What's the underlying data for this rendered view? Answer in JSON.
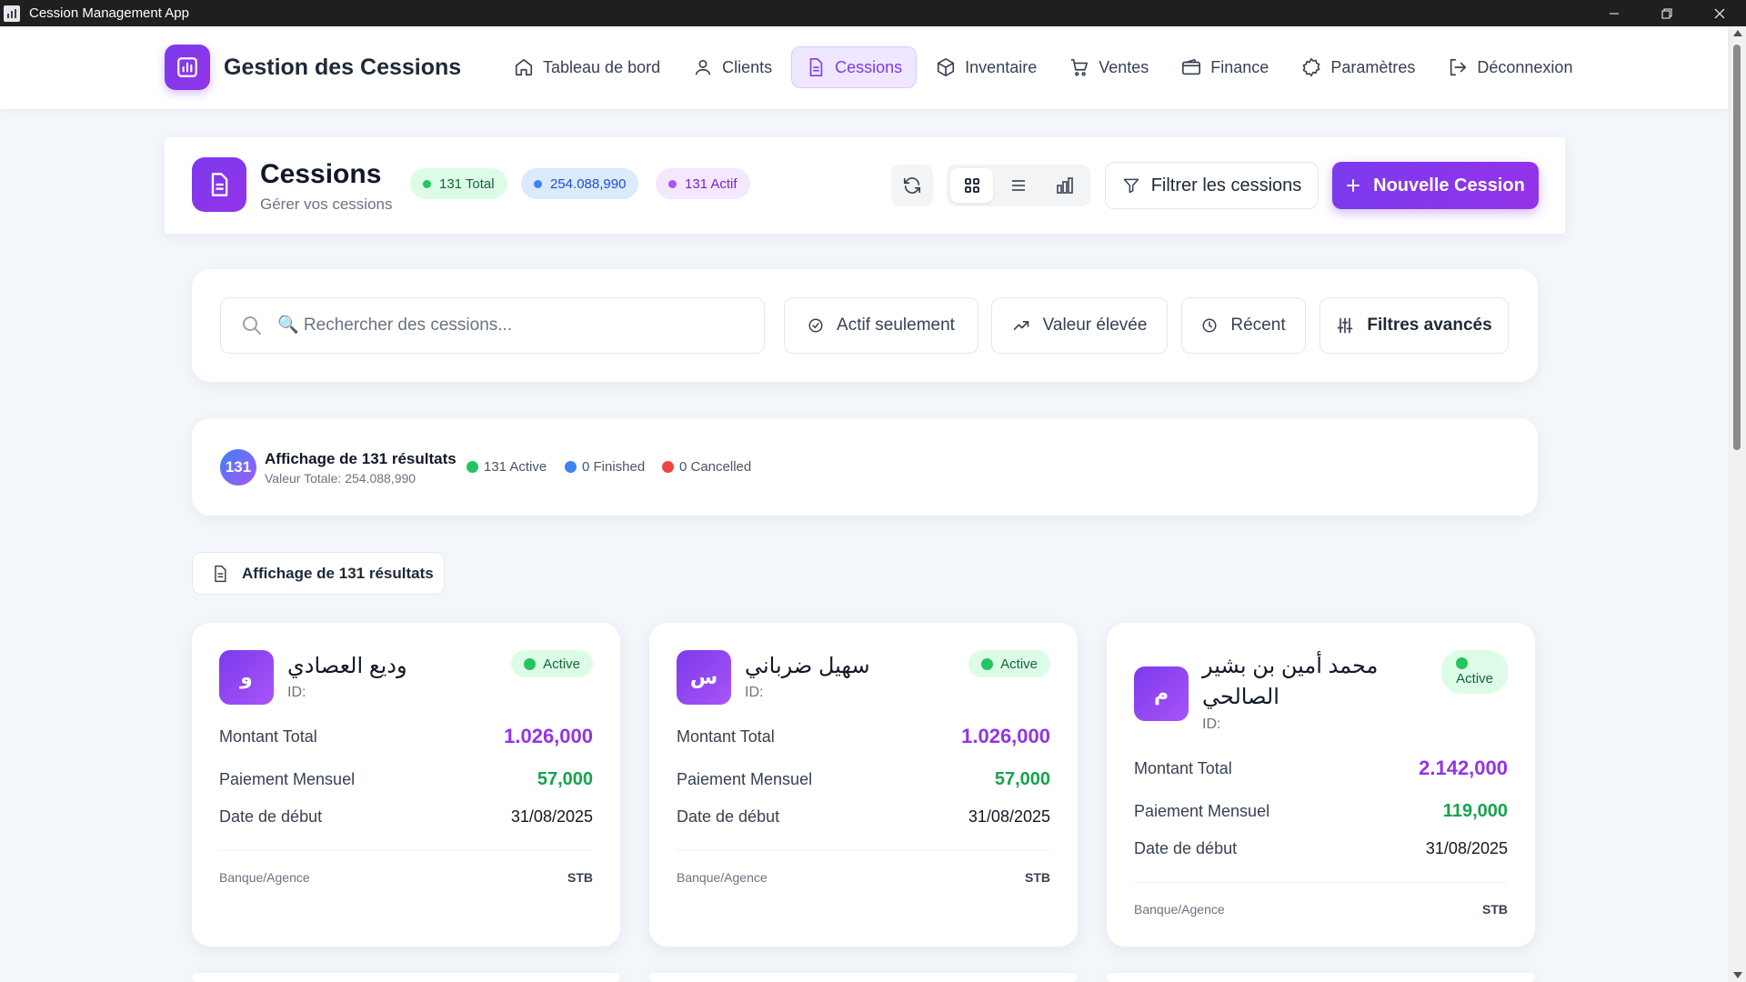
{
  "window": {
    "title": "Cession Management App"
  },
  "brand": {
    "title": "Gestion des Cessions"
  },
  "nav": {
    "items": [
      {
        "label": "Tableau de bord",
        "icon": "home-icon"
      },
      {
        "label": "Clients",
        "icon": "users-icon"
      },
      {
        "label": "Cessions",
        "icon": "document-icon",
        "active": true
      },
      {
        "label": "Inventaire",
        "icon": "box-icon"
      },
      {
        "label": "Ventes",
        "icon": "cart-icon"
      },
      {
        "label": "Finance",
        "icon": "wallet-icon"
      },
      {
        "label": "Paramètres",
        "icon": "gear-icon"
      },
      {
        "label": "Déconnexion",
        "icon": "logout-icon"
      }
    ]
  },
  "header": {
    "title": "Cessions",
    "subtitle": "Gérer vos cessions",
    "pills": {
      "total": "131 Total",
      "value": "254.088,990",
      "active": "131 Actif"
    },
    "filter_label": "Filtrer les cessions",
    "new_label": "Nouvelle Cession"
  },
  "search": {
    "placeholder": "🔍 Rechercher des cessions...",
    "chips": {
      "active_only": "Actif seulement",
      "high_value": "Valeur élevée",
      "recent": "Récent",
      "advanced": "Filtres avancés"
    }
  },
  "results": {
    "count": "131",
    "title": "Affichage de 131 résultats",
    "total_value": "Valeur Totale: 254.088,990",
    "legend": {
      "active": "131 Active",
      "finished": "0 Finished",
      "cancelled": "0 Cancelled"
    },
    "chip_label": "Affichage de 131 résultats"
  },
  "labels": {
    "total": "Montant Total",
    "monthly": "Paiement Mensuel",
    "start": "Date de début",
    "bank": "Banque/Agence",
    "id_prefix": "ID:"
  },
  "cards": [
    {
      "initial": "و",
      "name": "وديع العصادي",
      "status": "Active",
      "total": "1.026,000",
      "monthly": "57,000",
      "start": "31/08/2025",
      "bank": "STB"
    },
    {
      "initial": "س",
      "name": "سهيل ضرباني",
      "status": "Active",
      "total": "1.026,000",
      "monthly": "57,000",
      "start": "31/08/2025",
      "bank": "STB"
    },
    {
      "initial": "م",
      "name_line1": "محمد أمين بن بشير",
      "name_line2": "الصالحي",
      "status": "Active",
      "total": "2.142,000",
      "monthly": "119,000",
      "start": "31/08/2025",
      "bank": "STB"
    }
  ],
  "colors": {
    "accent": "#7c3aed",
    "success": "#22c55e",
    "info": "#3b82f6",
    "danger": "#ef4444"
  }
}
